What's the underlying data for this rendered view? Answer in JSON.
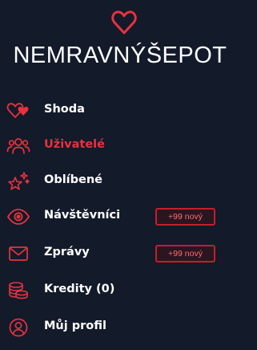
{
  "brand": {
    "name": "NEMRAVNÝŠEPOT",
    "accent_color": "#e8323e",
    "background_color": "#131a2a"
  },
  "menu": {
    "items": [
      {
        "label": "Shoda",
        "icon": "heart-match-icon",
        "active": false
      },
      {
        "label": "Uživatelé",
        "icon": "users-icon",
        "active": true
      },
      {
        "label": "Oblíbené",
        "icon": "sparkle-star-icon",
        "active": false
      },
      {
        "label": "Návštěvníci",
        "icon": "eye-icon",
        "active": false,
        "badge": "+99 nový"
      },
      {
        "label": "Zprávy",
        "icon": "envelope-icon",
        "active": false,
        "badge": "+99 nový"
      },
      {
        "label": "Kredity (0)",
        "icon": "coins-icon",
        "active": false
      },
      {
        "label": "Můj profil",
        "icon": "user-circle-icon",
        "active": false
      }
    ]
  }
}
